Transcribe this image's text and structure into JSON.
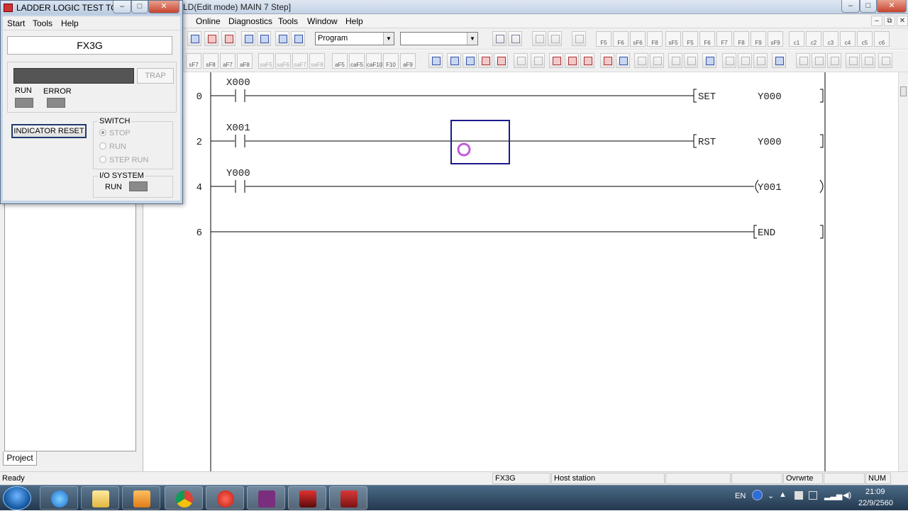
{
  "main_window": {
    "title": "LD(Edit mode)    MAIN    7 Step]",
    "controls": {
      "minimize": "–",
      "maximize": "□",
      "close": "✕"
    },
    "menu": [
      "Online",
      "Diagnostics",
      "Tools",
      "Window",
      "Help"
    ],
    "mdi_controls": {
      "minimize": "–",
      "restore": "⧉",
      "close": "✕"
    }
  },
  "toolbar": {
    "mode_combo": "Program",
    "second_combo": "",
    "row1_fkeys": [
      "F5",
      "F6",
      "sF6",
      "F8",
      "sF5",
      "F5",
      "F6",
      "F7",
      "F8",
      "F9",
      "sF9",
      "c1",
      "c2",
      "c3",
      "c4",
      "c5",
      "c6"
    ],
    "row2_left_keys": [
      "sF7",
      "sF8",
      "aF7",
      "aF8",
      "saF5",
      "saF6",
      "saF7",
      "saF8",
      "aF5",
      "caF5",
      "caF10",
      "F10",
      "aF9"
    ]
  },
  "project_tab": "Project",
  "ladder": {
    "rungs": [
      {
        "step": "0",
        "contact": "X000",
        "instruction": "SET",
        "operand": "Y000",
        "type": "bracket"
      },
      {
        "step": "2",
        "contact": "X001",
        "instruction": "RST",
        "operand": "Y000",
        "type": "bracket"
      },
      {
        "step": "4",
        "contact": "Y000",
        "instruction": "",
        "operand": "Y001",
        "type": "coil"
      },
      {
        "step": "6",
        "contact": "",
        "instruction": "END",
        "operand": "",
        "type": "bracket"
      }
    ],
    "cursor_color": "#1a1a8c",
    "busy_indicator_color": "#c25bd8"
  },
  "statusbar": {
    "ready": "Ready",
    "plc": "FX3G",
    "station": "Host station",
    "mode": "Ovrwrte",
    "numlock": "NUM"
  },
  "taskbar": {
    "apps": [
      "internet-explorer",
      "file-explorer",
      "media-player",
      "chrome",
      "record",
      "gpp-app",
      "plc-app",
      "simulator-app"
    ],
    "tray": {
      "lang": "EN",
      "time": "21:09",
      "date": "22/9/2560"
    }
  },
  "llt_dialog": {
    "title": "LADDER LOGIC TEST TO...",
    "menu": [
      "Start",
      "Tools",
      "Help"
    ],
    "cpu": "FX3G",
    "trap_button": "TRAP",
    "leds": {
      "run": "RUN",
      "error": "ERROR"
    },
    "indicator_reset": "INDICATOR RESET",
    "switch": {
      "legend": "SWITCH",
      "options": [
        "STOP",
        "RUN",
        "STEP RUN"
      ],
      "selected": "STOP"
    },
    "io_system": {
      "legend": "I/O SYSTEM",
      "label": "RUN"
    }
  }
}
